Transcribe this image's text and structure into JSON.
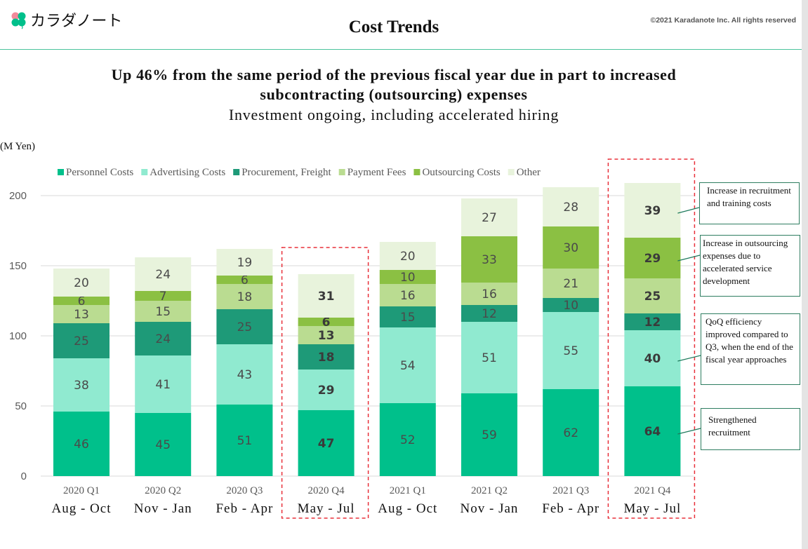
{
  "header": {
    "logo_text": "カラダノート",
    "title": "Cost Trends",
    "copyright": "©2021 Karadanote Inc. All rights reserved",
    "accent_color": "#4cc49c"
  },
  "headline": {
    "line1": "Up 46% from the same period of the previous fiscal year due in part to increased",
    "line2": "subcontracting (outsourcing) expenses",
    "subline": "Investment ongoing, including accelerated hiring"
  },
  "chart_data": {
    "type": "bar",
    "stacked": true,
    "title": "Cost Trends",
    "ylabel": "(M Yen)",
    "xlabel": "",
    "ylim": [
      0,
      200
    ],
    "yticks": [
      0,
      50,
      100,
      150,
      200
    ],
    "grid": true,
    "legend_position": "top",
    "categories": [
      "2020 Q1",
      "2020 Q2",
      "2020 Q3",
      "2020 Q4",
      "2021 Q1",
      "2021 Q2",
      "2021 Q3",
      "2021 Q4"
    ],
    "category_sublabels": [
      "Aug - Oct",
      "Nov - Jan",
      "Feb - Apr",
      "May - Jul",
      "Aug - Oct",
      "Nov - Jan",
      "Feb - Apr",
      "May - Jul"
    ],
    "highlighted_categories": [
      "2020 Q4",
      "2021 Q4"
    ],
    "series": [
      {
        "name": "Personnel Costs",
        "color": "#00c08b",
        "values": [
          46,
          45,
          51,
          47,
          52,
          59,
          62,
          64
        ]
      },
      {
        "name": "Advertising Costs",
        "color": "#90ead0",
        "values": [
          38,
          41,
          43,
          29,
          54,
          51,
          55,
          40
        ]
      },
      {
        "name": "Procurement, Freight",
        "color": "#1e9a78",
        "values": [
          25,
          24,
          25,
          18,
          15,
          12,
          10,
          12
        ]
      },
      {
        "name": "Payment Fees",
        "color": "#badc91",
        "values": [
          13,
          15,
          18,
          13,
          16,
          16,
          21,
          25
        ]
      },
      {
        "name": "Outsourcing Costs",
        "color": "#8bc043",
        "values": [
          6,
          7,
          6,
          6,
          10,
          33,
          30,
          29
        ]
      },
      {
        "name": "Other",
        "color": "#e8f3dc",
        "values": [
          20,
          24,
          19,
          31,
          20,
          27,
          28,
          39
        ]
      }
    ],
    "annotations": [
      {
        "text": "Increase in recruitment and training costs",
        "target_series": "Other",
        "target_category": "2021 Q4"
      },
      {
        "text": "Increase in outsourcing expenses due to accelerated service development",
        "target_series": "Outsourcing Costs",
        "target_category": "2021 Q4"
      },
      {
        "text": "QoQ efficiency improved compared to Q3, when the end of the fiscal year approaches",
        "target_series": "Advertising Costs",
        "target_category": "2021 Q4"
      },
      {
        "text": "Strengthened recruitment",
        "target_series": "Personnel Costs",
        "target_category": "2021 Q4"
      }
    ]
  }
}
